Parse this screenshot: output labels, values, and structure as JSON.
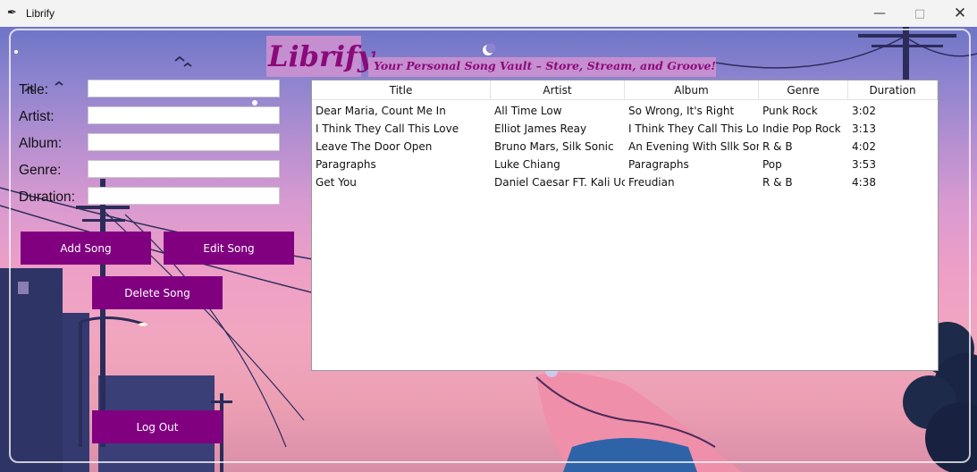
{
  "window": {
    "title": "Librify",
    "icon": "feather-icon",
    "controls": [
      "minimize-icon",
      "maximize-icon",
      "close-icon"
    ]
  },
  "header": {
    "logo": "Librify",
    "tagline": "Your Personal Song Vault – Store, Stream, and Groove!"
  },
  "form": {
    "title_label": "Title:",
    "artist_label": "Artist:",
    "album_label": "Album:",
    "genre_label": "Genre:",
    "duration_label": "Duration:",
    "title_value": "",
    "artist_value": "",
    "album_value": "",
    "genre_value": "",
    "duration_value": ""
  },
  "buttons": {
    "add": "Add Song",
    "edit": "Edit Song",
    "delete": "Delete Song",
    "logout": "Log Out"
  },
  "table": {
    "columns": [
      "Title",
      "Artist",
      "Album",
      "Genre",
      "Duration"
    ],
    "rows": [
      [
        "Dear Maria, Count Me In",
        "All Time Low",
        "So Wrong, It's Right",
        "Punk Rock",
        "3:02"
      ],
      [
        "I Think They Call This Love",
        "Elliot James Reay",
        "I Think They Call This Love",
        "Indie Pop Rock",
        "3:13"
      ],
      [
        "Leave The Door Open",
        "Bruno Mars, Silk Sonic",
        "An Evening With Sllk Sonic",
        "R & B",
        "4:02"
      ],
      [
        "Paragraphs",
        "Luke Chiang",
        "Paragraphs",
        "Pop",
        "3:53"
      ],
      [
        "Get You",
        "Daniel Caesar FT. Kali Uchis",
        "Freudian",
        "R & B",
        "4:38"
      ]
    ]
  },
  "colors": {
    "button_bg": "#800080",
    "logo_text": "#8b0a7a",
    "logo_bg": "#c88fd0"
  }
}
